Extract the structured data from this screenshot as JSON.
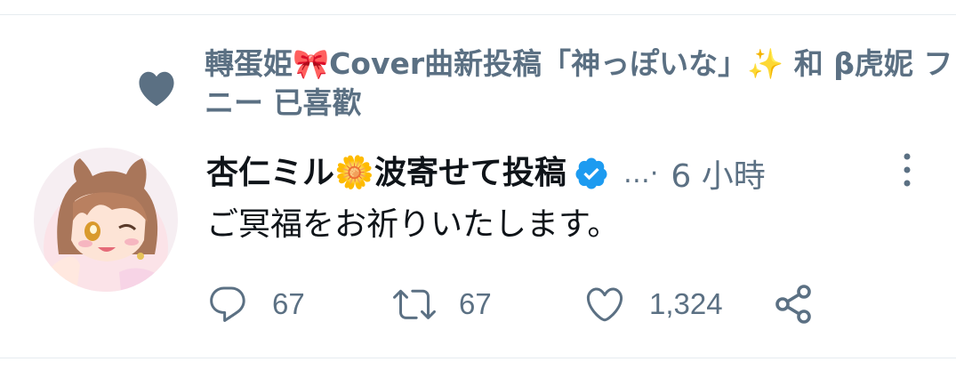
{
  "social_context": {
    "text": "轉蛋姫🎀Cover曲新投稿「神っぽいな」✨ 和 β虎妮 フニー 已喜歡"
  },
  "tweet": {
    "display_name": "杏仁ミル🌼波寄せて投稿",
    "ellipsis": "…·",
    "timestamp": "6 小時",
    "text": "ご冥福をお祈りいたします。"
  },
  "actions": {
    "reply_count": "67",
    "retweet_count": "67",
    "like_count": "1,324"
  },
  "colors": {
    "secondary_text": "#5b7083",
    "primary_text": "#0f1419",
    "verified_blue": "#1d9bf0",
    "divider": "#e6ecf0"
  }
}
